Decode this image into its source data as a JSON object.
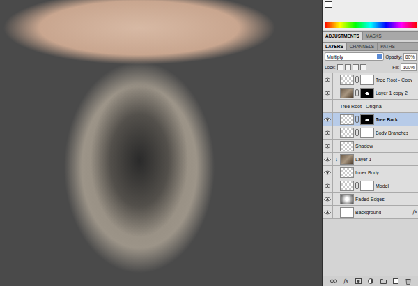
{
  "panel_top_tabs": [
    {
      "label": "ADJUSTMENTS",
      "selected": true
    },
    {
      "label": "MASKS",
      "selected": false
    }
  ],
  "panel_tabs": [
    {
      "label": "LAYERS",
      "selected": true
    },
    {
      "label": "CHANNELS",
      "selected": false
    },
    {
      "label": "PATHS",
      "selected": false
    }
  ],
  "blend_mode": "Multiply",
  "opacity": {
    "label": "Opacity:",
    "value": "80%"
  },
  "lock": {
    "label": "Lock:"
  },
  "fill": {
    "label": "Fill:",
    "value": "100%"
  },
  "layers": [
    {
      "name": "Tree Root - Copy",
      "visible": true,
      "selected": false,
      "thumb": "checker",
      "mask": "white",
      "underline": false,
      "clipped": false,
      "badge": ""
    },
    {
      "name": "Layer 1 copy 2",
      "visible": true,
      "selected": false,
      "thumb": "image",
      "mask": "black",
      "underline": false,
      "clipped": false,
      "badge": ""
    },
    {
      "name": "Tree Root - Original",
      "visible": false,
      "selected": false,
      "thumb": "none",
      "mask": "none",
      "underline": false,
      "clipped": false,
      "badge": ""
    },
    {
      "name": "Tree Bark",
      "visible": true,
      "selected": true,
      "thumb": "checker",
      "mask": "black",
      "underline": false,
      "clipped": false,
      "badge": ""
    },
    {
      "name": "Body Branches",
      "visible": true,
      "selected": false,
      "thumb": "checker",
      "mask": "white",
      "underline": false,
      "clipped": false,
      "badge": ""
    },
    {
      "name": "Shadow",
      "visible": true,
      "selected": false,
      "thumb": "checker",
      "mask": "none",
      "underline": false,
      "clipped": false,
      "badge": ""
    },
    {
      "name": "Layer 1",
      "visible": true,
      "selected": false,
      "thumb": "image",
      "mask": "none",
      "underline": false,
      "clipped": true,
      "badge": ""
    },
    {
      "name": "Inner Body",
      "visible": true,
      "selected": false,
      "thumb": "checker",
      "mask": "none",
      "underline": true,
      "clipped": false,
      "badge": ""
    },
    {
      "name": "Model",
      "visible": true,
      "selected": false,
      "thumb": "checker",
      "mask": "white",
      "underline": false,
      "clipped": false,
      "badge": ""
    },
    {
      "name": "Faded Edges",
      "visible": true,
      "selected": false,
      "thumb": "gradient",
      "mask": "none",
      "underline": false,
      "clipped": false,
      "badge": ""
    },
    {
      "name": "Background",
      "visible": true,
      "selected": false,
      "thumb": "white",
      "mask": "none",
      "underline": false,
      "clipped": false,
      "badge": "fx"
    }
  ],
  "bottom_bar": {
    "fx": "fx"
  }
}
